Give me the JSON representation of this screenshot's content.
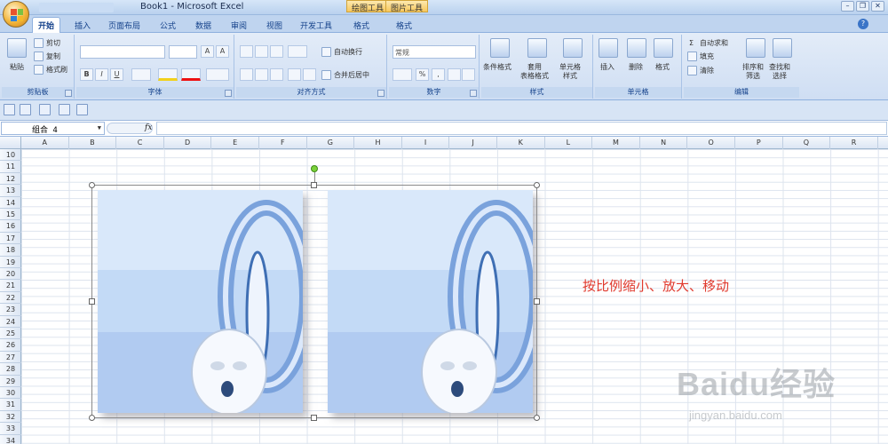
{
  "window": {
    "title": "Book1 - Microsoft Excel",
    "contextual_tabs": [
      "绘图工具",
      "图片工具"
    ]
  },
  "ribbon_tabs": [
    "开始",
    "插入",
    "页面布局",
    "公式",
    "数据",
    "审阅",
    "视图",
    "开发工具",
    "格式",
    "格式"
  ],
  "active_tab": "开始",
  "ribbon": {
    "clipboard": {
      "label": "剪贴板",
      "paste": "粘贴",
      "cut": "剪切",
      "copy": "复制",
      "format_painter": "格式刷"
    },
    "font": {
      "label": "字体",
      "bold": "B",
      "italic": "I",
      "underline": "U"
    },
    "alignment": {
      "label": "对齐方式",
      "wrap_text": "自动换行",
      "merge_center": "合并后居中"
    },
    "number": {
      "label": "数字",
      "format": "常规"
    },
    "styles": {
      "label": "样式",
      "conditional": "条件格式",
      "table_format": "套用\n表格格式",
      "cell_styles": "单元格\n样式"
    },
    "cells": {
      "label": "单元格",
      "insert": "插入",
      "delete": "删除",
      "format": "格式"
    },
    "editing": {
      "label": "编辑",
      "autosum": "自动求和",
      "fill": "填充",
      "clear": "清除",
      "sort_filter": "排序和\n筛选",
      "find_select": "查找和\n选择"
    }
  },
  "formula_bar": {
    "name_box": "组合 4",
    "fx": "fx",
    "formula": ""
  },
  "columns": [
    "A",
    "B",
    "C",
    "D",
    "E",
    "F",
    "G",
    "H",
    "I",
    "J",
    "K",
    "L",
    "M",
    "N",
    "O",
    "P",
    "Q",
    "R"
  ],
  "rows": [
    "10",
    "11",
    "12",
    "13",
    "14",
    "15",
    "16",
    "17",
    "18",
    "19",
    "20",
    "21",
    "22",
    "23",
    "24",
    "25",
    "26",
    "27",
    "28",
    "29",
    "30",
    "31",
    "32",
    "33",
    "34"
  ],
  "annotation": "按比例缩小、放大、移动",
  "watermark": {
    "brand": "Baidu经验",
    "url": "jingyan.baidu.com"
  },
  "colors": {
    "annotation": "#e03a2e",
    "ribbon": "#cfdef3",
    "selection_handle": "#7bd23a"
  }
}
